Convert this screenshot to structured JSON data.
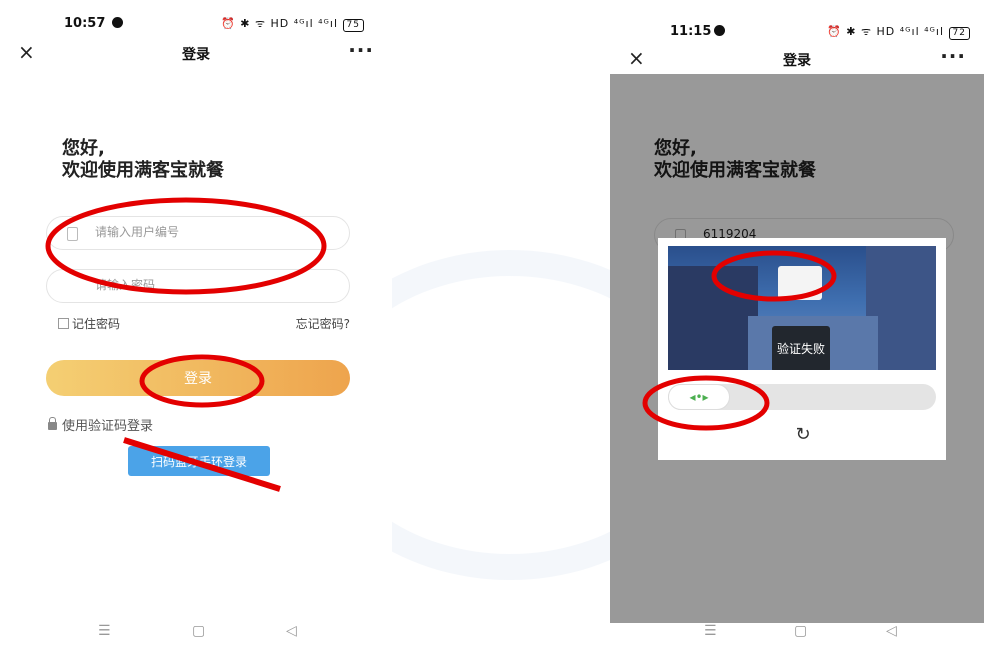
{
  "left": {
    "status": {
      "time": "10:57",
      "icons": "⏰ ✱ ᯤ HD ⁴ᴳıl ⁴ᴳıl",
      "battery": "75"
    },
    "nav": {
      "close": "×",
      "title": "登录",
      "more": "···"
    },
    "greeting_line1": "您好,",
    "greeting_line2": "欢迎使用满客宝就餐",
    "username_placeholder": "请输入用户编号",
    "password_placeholder": "请输入密码",
    "remember_label": "记住密码",
    "forgot_label": "忘记密码?",
    "login_label": "登录",
    "sms_login_label": "使用验证码登录",
    "scan_label": "扫码蓝牙手环登录",
    "bottom_nav": {
      "menu": "☰",
      "home": "▢",
      "back": "◁"
    }
  },
  "right": {
    "status": {
      "time": "11:15",
      "icons": "⏰ ✱ ᯤ HD ⁴ᴳıl ⁴ᴳıl",
      "battery": "72"
    },
    "nav": {
      "close": "×",
      "title": "登录",
      "more": "···"
    },
    "greeting_line1": "您好,",
    "greeting_line2": "欢迎使用满客宝就餐",
    "username_value": "6119204",
    "captcha": {
      "fail_text": "验证失败",
      "slider_arrows": "◂•▸",
      "refresh": "↻"
    },
    "bottom_nav": {
      "menu": "☰",
      "home": "▢",
      "back": "◁"
    }
  },
  "colors": {
    "login_gradient_start": "#f4cf73",
    "login_gradient_end": "#eea44d",
    "scan_button": "#4ba3e8",
    "annotation_red": "#e30000",
    "slider_green": "#4caf50"
  }
}
